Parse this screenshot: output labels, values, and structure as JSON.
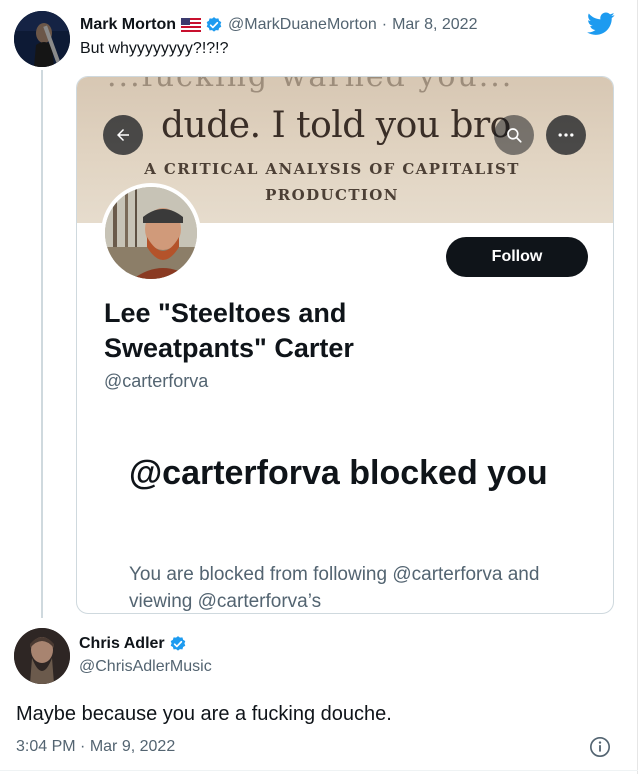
{
  "tweet1": {
    "name": "Mark Morton",
    "handle": "@MarkDuaneMorton",
    "separator": "·",
    "date": "Mar 8, 2022",
    "text": "But whyyyyyyyy?!?!?"
  },
  "card": {
    "banner_top_text": "...fucking warned you...",
    "banner_big_text": "dude. I told you bro",
    "banner_sub_line1": "A CRITICAL ANALYSIS OF CAPITALIST",
    "banner_sub_line2": "PRODUCTION",
    "follow_label": "Follow",
    "profile_name": "Lee \"Steeltoes and Sweatpants\" Carter",
    "profile_handle": "@carterforva",
    "blocked_title": "@carterforva blocked you",
    "blocked_desc": "You are blocked from following @carterforva and viewing @carterforva’s"
  },
  "tweet2": {
    "name": "Chris Adler",
    "handle": "@ChrisAdlerMusic",
    "text": "Maybe because you are a fucking douche.",
    "time": "3:04 PM",
    "separator": "·",
    "date": "Mar 9, 2022"
  },
  "icons": {
    "verified": "verified-badge-icon",
    "flag": "us-flag-icon",
    "logo": "twitter-bird-icon",
    "info": "info-icon"
  },
  "colors": {
    "verified_blue": "#1d9bf0",
    "text_primary": "#0f1419",
    "text_secondary": "#536471",
    "follow_button": "#0f1419"
  }
}
